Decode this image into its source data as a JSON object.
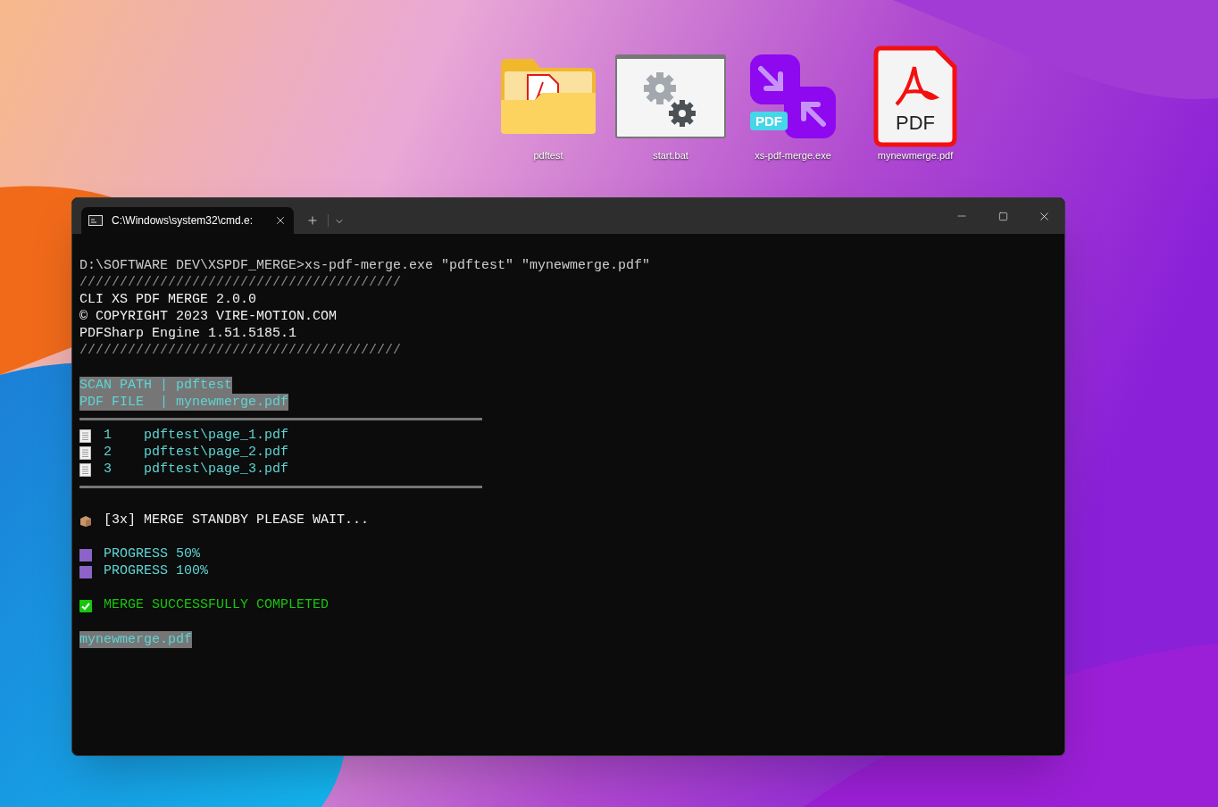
{
  "desktop_icons": [
    {
      "kind": "folder",
      "label": "pdftest"
    },
    {
      "kind": "batch",
      "label": "start.bat"
    },
    {
      "kind": "app",
      "label": "xs-pdf-merge.exe",
      "badge": "PDF"
    },
    {
      "kind": "pdf",
      "label": "mynewmerge.pdf",
      "badge": "PDF"
    }
  ],
  "terminal": {
    "tab_title": "C:\\Windows\\system32\\cmd.e:",
    "lines": [
      {
        "kind": "command",
        "text": "D:\\SOFTWARE DEV\\XSPDF_MERGE>xs-pdf-merge.exe \"pdftest\" \"mynewmerge.pdf\""
      },
      {
        "kind": "rule",
        "text": "////////////////////////////////////////"
      },
      {
        "kind": "text",
        "text": "CLI XS PDF MERGE 2.0.0"
      },
      {
        "kind": "text",
        "text": "© COPYRIGHT 2023 VIRE-MOTION.COM"
      },
      {
        "kind": "text",
        "text": "PDFSharp Engine 1.51.5185.1"
      },
      {
        "kind": "rule",
        "text": "////////////////////////////////////////"
      },
      {
        "kind": "blank"
      },
      {
        "kind": "highlight",
        "text": "SCAN PATH | pdftest"
      },
      {
        "kind": "highlight",
        "text": "PDF FILE  | mynewmerge.pdf"
      },
      {
        "kind": "divider"
      },
      {
        "kind": "file",
        "number": "1",
        "text": "pdftest\\page_1.pdf"
      },
      {
        "kind": "file",
        "number": "2",
        "text": "pdftest\\page_2.pdf"
      },
      {
        "kind": "file",
        "number": "3",
        "text": "pdftest\\page_3.pdf"
      },
      {
        "kind": "divider"
      },
      {
        "kind": "blank"
      },
      {
        "kind": "package",
        "text": "[3x] MERGE STANDBY PLEASE WAIT..."
      },
      {
        "kind": "blank"
      },
      {
        "kind": "progress",
        "text": "PROGRESS 50%"
      },
      {
        "kind": "progress",
        "text": "PROGRESS 100%"
      },
      {
        "kind": "blank"
      },
      {
        "kind": "success",
        "text": "MERGE SUCCESSFULLY COMPLETED"
      },
      {
        "kind": "blank"
      },
      {
        "kind": "highlight",
        "text": "mynewmerge.pdf"
      }
    ]
  }
}
